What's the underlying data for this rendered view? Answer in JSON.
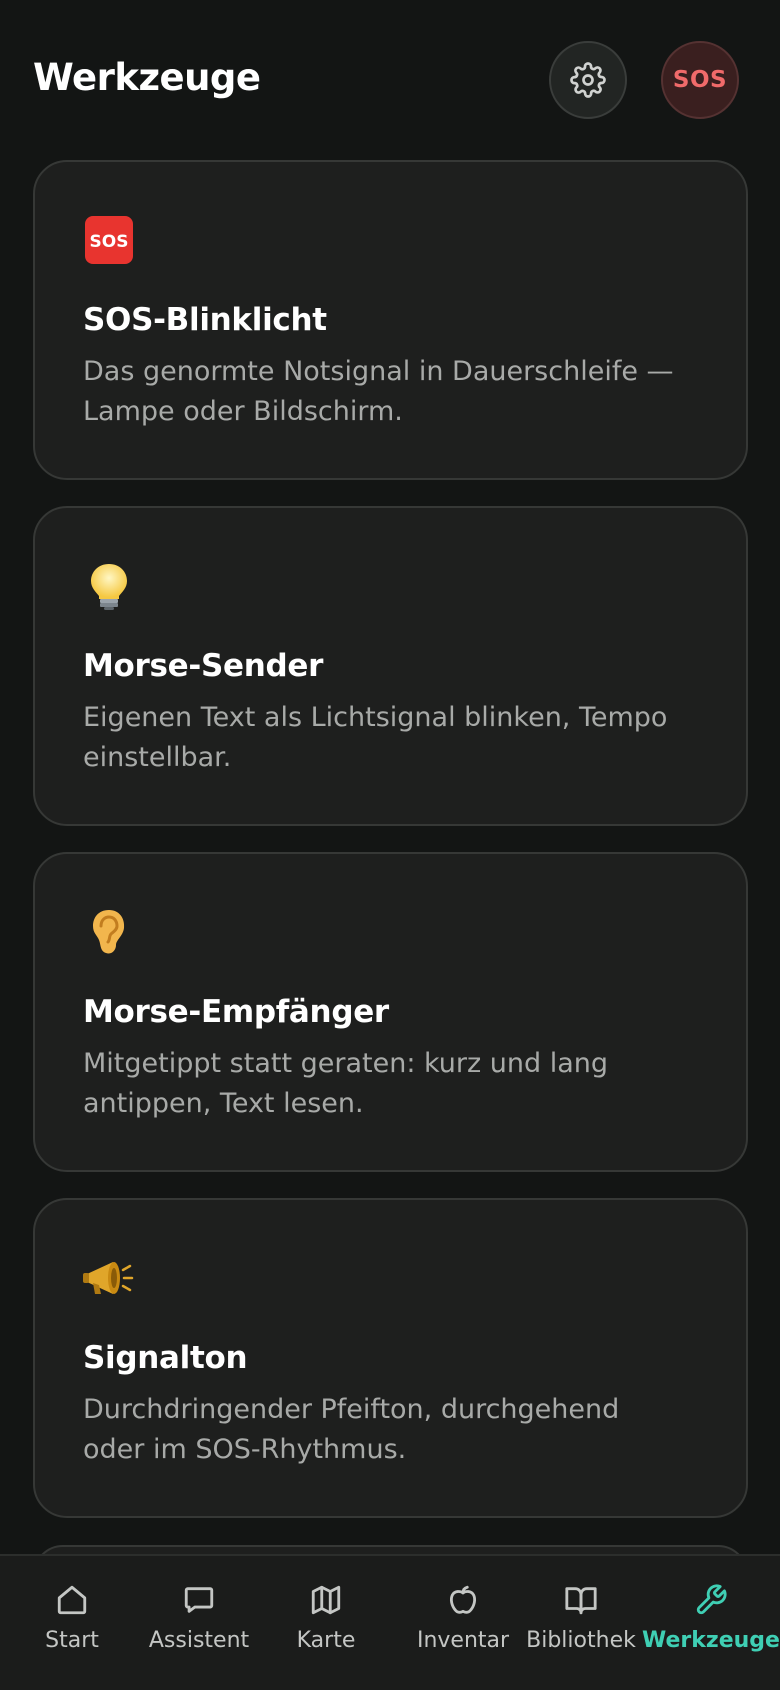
{
  "header": {
    "title": "Werkzeuge",
    "settings_icon": "gear-icon",
    "sos_label": "SOS"
  },
  "tools": [
    {
      "icon": "sos-icon",
      "title": "SOS-Blinklicht",
      "description": "Das genormte Notsignal in Dauerschleife — Lampe oder Bildschirm."
    },
    {
      "icon": "light-bulb-icon",
      "title": "Morse-Sender",
      "description": "Eigenen Text als Lichtsignal blinken, Tempo einstellbar."
    },
    {
      "icon": "ear-icon",
      "title": "Morse-Empfänger",
      "description": "Mitgetippt statt geraten: kurz und lang antippen, Text lesen."
    },
    {
      "icon": "megaphone-icon",
      "title": "Signalton",
      "description": "Durchdringender Pfeifton, durchgehend oder im SOS-Rhythmus."
    }
  ],
  "nav": {
    "items": [
      {
        "label": "Start",
        "icon": "home-icon"
      },
      {
        "label": "Assistent",
        "icon": "chat-icon"
      },
      {
        "label": "Karte",
        "icon": "map-icon"
      },
      {
        "label": "Inventar",
        "icon": "apple-icon"
      },
      {
        "label": "Bibliothek",
        "icon": "book-icon"
      },
      {
        "label": "Werkzeuge",
        "icon": "wrench-icon"
      }
    ],
    "active": "Werkzeuge"
  },
  "colors": {
    "background": "#131514",
    "card": "#1e1f1e",
    "accent": "#3fcfb4",
    "sos": "#f06a6a"
  }
}
